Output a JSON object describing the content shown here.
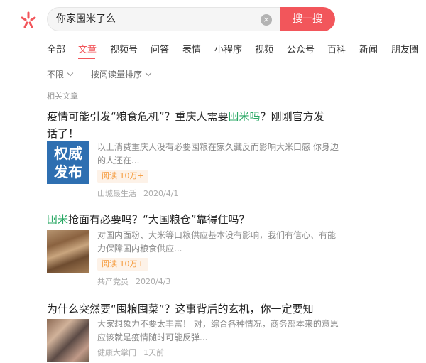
{
  "search": {
    "query": "你家囤米了么",
    "button_label": "搜一搜",
    "clear_glyph": "×"
  },
  "tabs": [
    {
      "label": "全部"
    },
    {
      "label": "文章"
    },
    {
      "label": "视频号"
    },
    {
      "label": "问答"
    },
    {
      "label": "表情"
    },
    {
      "label": "小程序"
    },
    {
      "label": "视频"
    },
    {
      "label": "公众号"
    },
    {
      "label": "百科"
    },
    {
      "label": "新闻"
    },
    {
      "label": "朋友圈"
    }
  ],
  "active_tab": "文章",
  "filters": {
    "time": "不限",
    "sort": "按阅读量排序"
  },
  "section_label": "相关文章",
  "articles": [
    {
      "title_before": "疫情可能引发“粮食危机”？重庆人需要",
      "title_highlight": "囤米吗",
      "title_after": "？刚刚官方发话了！",
      "thumb_text_line1": "权威",
      "thumb_text_line2": "发布",
      "snippet": "以上消费重庆人没有必要囤粮在家久藏反而影响大米口感 你身边的人还在...",
      "reads": "阅读 10万+",
      "source": "山城最生活",
      "date": "2020/4/1"
    },
    {
      "title_before": "",
      "title_highlight": "囤米",
      "title_after": "抢面有必要吗？“大国粮仓”靠得住吗？",
      "snippet": "对国内面粉、大米等口粮供应基本没有影响，我们有信心、有能力保障国内粮食供应...",
      "reads": "阅读 10万+",
      "source": "共产党员",
      "date": "2020/4/3"
    },
    {
      "title_before": "为什么突然要“囤粮囤菜”？这事背后的玄机，你一定要知道......",
      "title_highlight": "",
      "title_after": "",
      "snippet": "大家想象力不要太丰富！ 对，综合各种情况，商务部本来的意思应该就是疫情随时可能反弹...",
      "source": "健康大掌门",
      "date": "1天前"
    }
  ],
  "colors": {
    "accent": "#f2565b",
    "highlight": "#2aa865",
    "badge_text": "#f59a3b"
  }
}
